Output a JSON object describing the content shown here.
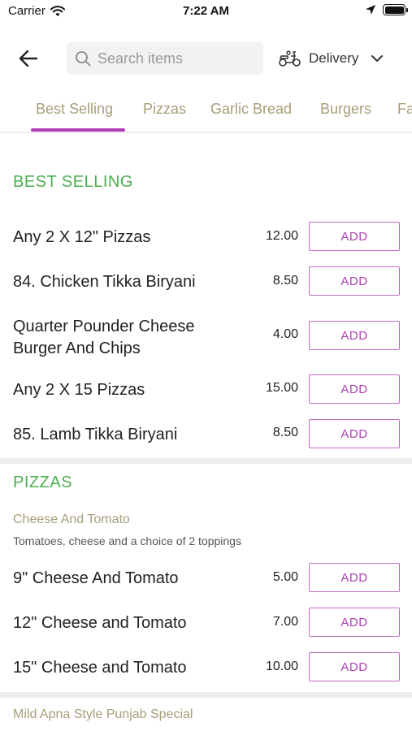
{
  "status_bar": {
    "carrier": "Carrier",
    "time": "7:22 AM"
  },
  "nav": {
    "search_placeholder": "Search items",
    "delivery_label": "Delivery"
  },
  "tabs": [
    {
      "label": "Best Selling",
      "active": true
    },
    {
      "label": "Pizzas",
      "active": false
    },
    {
      "label": "Garlic Bread",
      "active": false
    },
    {
      "label": "Burgers",
      "active": false
    },
    {
      "label": "Fa",
      "active": false
    }
  ],
  "sections": {
    "best_selling": {
      "title": "BEST SELLING",
      "items": [
        {
          "name": "Any 2 X 12\" Pizzas",
          "price": "12.00",
          "add_label": "ADD"
        },
        {
          "name": "84. Chicken Tikka Biryani",
          "price": "8.50",
          "add_label": "ADD"
        },
        {
          "name": "Quarter Pounder Cheese Burger And Chips",
          "price": "4.00",
          "add_label": "ADD"
        },
        {
          "name": "Any 2 X 15 Pizzas",
          "price": "15.00",
          "add_label": "ADD"
        },
        {
          "name": "85. Lamb Tikka Biryani",
          "price": "8.50",
          "add_label": "ADD"
        }
      ]
    },
    "pizzas": {
      "title": "PIZZAS",
      "subsection_title": "Cheese And Tomato",
      "subsection_desc": "Tomatoes, cheese and a choice of 2 toppings",
      "items": [
        {
          "name": "9\" Cheese And Tomato",
          "price": "5.00",
          "add_label": "ADD"
        },
        {
          "name": "12\" Cheese and Tomato",
          "price": "7.00",
          "add_label": "ADD"
        },
        {
          "name": "15\" Cheese and Tomato",
          "price": "10.00",
          "add_label": "ADD"
        }
      ]
    },
    "next_subsection": {
      "title": "Mild Apna Style Punjab Special"
    }
  },
  "colors": {
    "accent": "#b03fb5",
    "section_green": "#4caf50",
    "tab_text": "#a79f7a"
  },
  "icons": {
    "back": "arrow-left-icon",
    "search": "search-icon",
    "delivery": "scooter-icon",
    "chevron": "chevron-down-icon",
    "wifi": "wifi-icon",
    "location": "location-arrow-icon",
    "battery": "battery-icon"
  }
}
